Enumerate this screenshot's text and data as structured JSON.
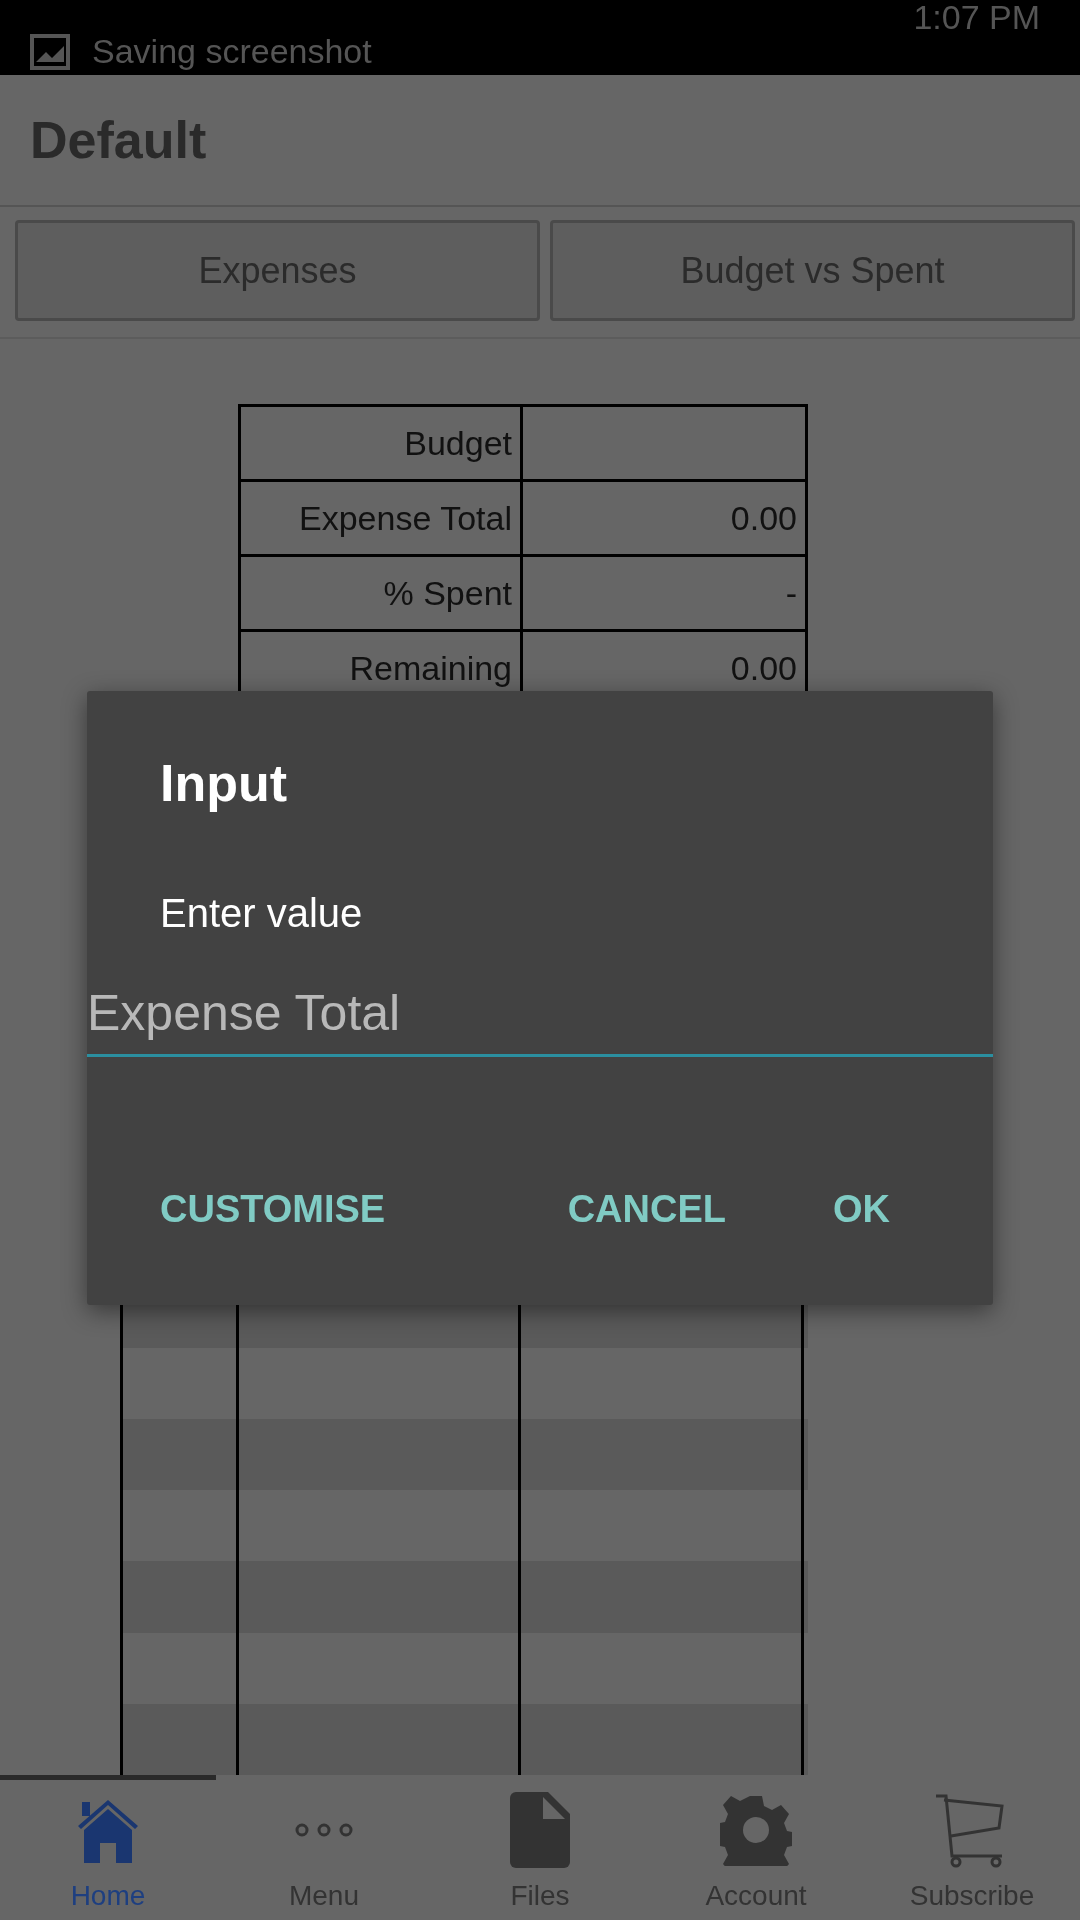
{
  "status_bar": {
    "notification": "Saving screenshot",
    "time": "1:07 PM"
  },
  "app_bar": {
    "title": "Default"
  },
  "view_buttons": [
    "Expenses",
    "Budget vs Spent"
  ],
  "summary_table": {
    "rows": [
      {
        "label": "Budget"
      },
      {
        "label": "Expense Total",
        "value": "0.00"
      },
      {
        "label": "% Spent",
        "value": "-"
      },
      {
        "label": "Remaining",
        "value": "0.00"
      }
    ]
  },
  "dialog": {
    "title": "Input",
    "message": "Enter value",
    "field": {
      "placeholder": "Expense Total"
    },
    "buttons": [
      "CUSTOMISE",
      "CANCEL",
      "OK"
    ]
  },
  "bottom_nav": [
    {
      "kind": "home",
      "label": "Home",
      "selected": true
    },
    {
      "kind": "menu",
      "label": "Menu",
      "selected": false
    },
    {
      "kind": "files",
      "label": "Files",
      "selected": false
    },
    {
      "kind": "account",
      "label": "Account",
      "selected": false
    },
    {
      "kind": "subscribe",
      "label": "Subscribe",
      "selected": false
    }
  ]
}
